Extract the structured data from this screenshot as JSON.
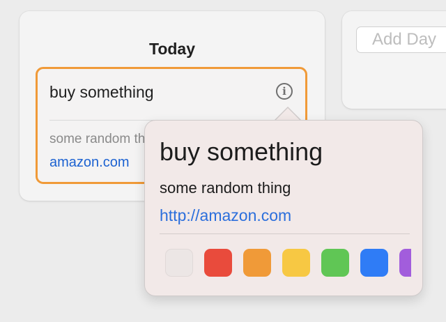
{
  "columns": {
    "today": {
      "title": "Today",
      "card": {
        "title": "buy something",
        "note": "some random thing",
        "link": "amazon.com"
      }
    },
    "add_day": {
      "placeholder": "Add Day"
    }
  },
  "popover": {
    "title": "buy something",
    "note": "some random thing",
    "link": "http://amazon.com",
    "colors": [
      {
        "name": "none",
        "hex": "#ece6e5"
      },
      {
        "name": "red",
        "hex": "#e94b3c"
      },
      {
        "name": "orange",
        "hex": "#f09a38"
      },
      {
        "name": "yellow",
        "hex": "#f7c843"
      },
      {
        "name": "green",
        "hex": "#60c655"
      },
      {
        "name": "blue",
        "hex": "#2f7cf6"
      },
      {
        "name": "purple",
        "hex": "#a25ddc"
      }
    ]
  },
  "accent_color": "#f09a38",
  "info_icon": "info-circle-icon"
}
